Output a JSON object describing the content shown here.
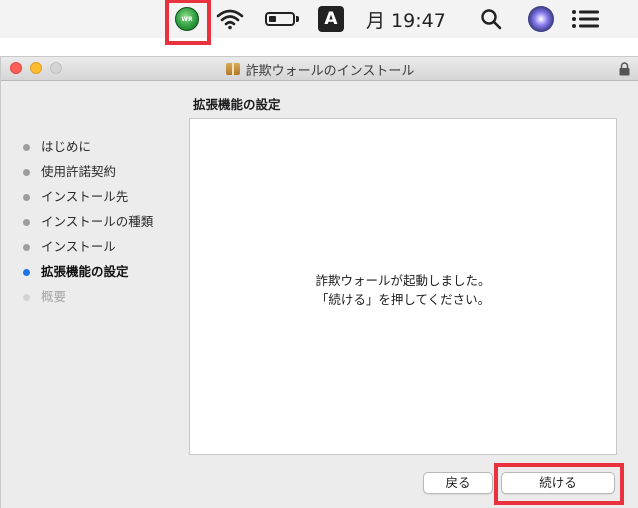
{
  "menubar": {
    "webroot_icon_text": "Web Root",
    "input_source": "A",
    "clock": "月 19:47",
    "battery_level": 0.3,
    "icons": [
      "webroot-icon",
      "wifi-icon",
      "battery-icon",
      "input-source-icon",
      "search-icon",
      "siri-icon",
      "notification-center-icon"
    ]
  },
  "window": {
    "title": "詐欺ウォールのインストール",
    "section_title": "拡張機能の設定",
    "steps": [
      {
        "label": "はじめに",
        "state": "done"
      },
      {
        "label": "使用許諾契約",
        "state": "done"
      },
      {
        "label": "インストール先",
        "state": "done"
      },
      {
        "label": "インストールの種類",
        "state": "done"
      },
      {
        "label": "インストール",
        "state": "done"
      },
      {
        "label": "拡張機能の設定",
        "state": "current"
      },
      {
        "label": "概要",
        "state": "future"
      }
    ],
    "message_line1": "詐欺ウォールが起動しました。",
    "message_line2": "「続ける」を押してください。",
    "back_label": "戻る",
    "continue_label": "続ける"
  },
  "colors": {
    "highlight": "#e8333f",
    "current_step": "#1f73e6",
    "close": "#fc5f57",
    "minimize": "#fdbc2e"
  }
}
